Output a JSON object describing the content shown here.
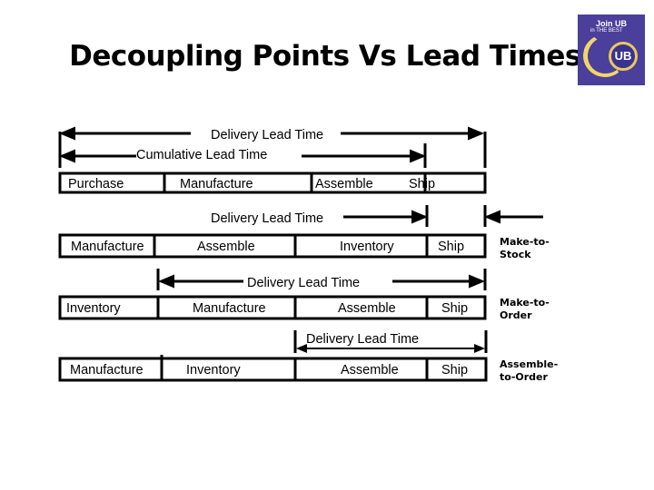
{
  "title": "Decoupling Points Vs Lead Times",
  "logo": {
    "line1": "Join UB",
    "line2": "in THE BEST",
    "badge": "UB",
    "footer": "..."
  },
  "top_row": {
    "delivery_label": "Delivery Lead Time",
    "cumulative_label": "Cumulative Lead Time",
    "cells": [
      "Purchase",
      "Manufacture",
      "Assemble",
      "Ship"
    ]
  },
  "rows": [
    {
      "delivery_label": "Delivery Lead Time",
      "cells": [
        "Manufacture",
        "Assemble",
        "Inventory",
        "Ship"
      ],
      "strategy": [
        "Make-to-",
        "Stock"
      ]
    },
    {
      "delivery_label": "Delivery Lead Time",
      "cells": [
        "Inventory",
        "Manufacture",
        "Assemble",
        "Ship"
      ],
      "strategy": [
        "Make-to-",
        "Order"
      ]
    },
    {
      "delivery_label": "Delivery Lead Time",
      "cells": [
        "Manufacture",
        "Inventory",
        "Assemble",
        "Ship"
      ],
      "strategy": [
        "Assemble-",
        "to-Order"
      ]
    }
  ]
}
